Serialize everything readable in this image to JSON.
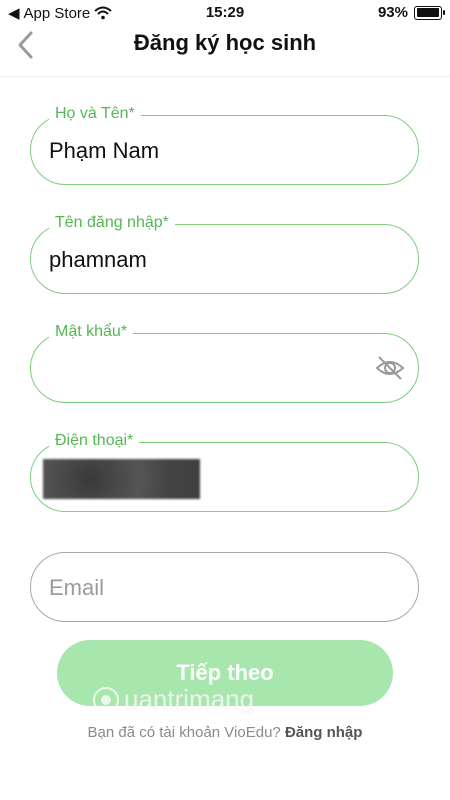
{
  "status_bar": {
    "carrier": "App Store",
    "time": "15:29",
    "battery": "93%"
  },
  "nav": {
    "title": "Đăng ký học sinh"
  },
  "fields": {
    "full_name": {
      "label": "Họ và Tên*",
      "value": "Phạm Nam"
    },
    "username": {
      "label": "Tên đăng nhập*",
      "value": "phamnam"
    },
    "password": {
      "label": "Mật khẩu*",
      "value": ""
    },
    "phone": {
      "label": "Điện thoại*"
    },
    "email": {
      "placeholder": "Email"
    }
  },
  "buttons": {
    "next": "Tiếp theo"
  },
  "footer": {
    "prompt": "Bạn đã có tài khoản VioEdu?",
    "login": "Đăng nhập"
  },
  "watermark": {
    "text": "Quantrimang"
  },
  "colors": {
    "accent": "#55b655",
    "border_active": "#7ccf7c",
    "button_bg": "#a7e7ad"
  }
}
